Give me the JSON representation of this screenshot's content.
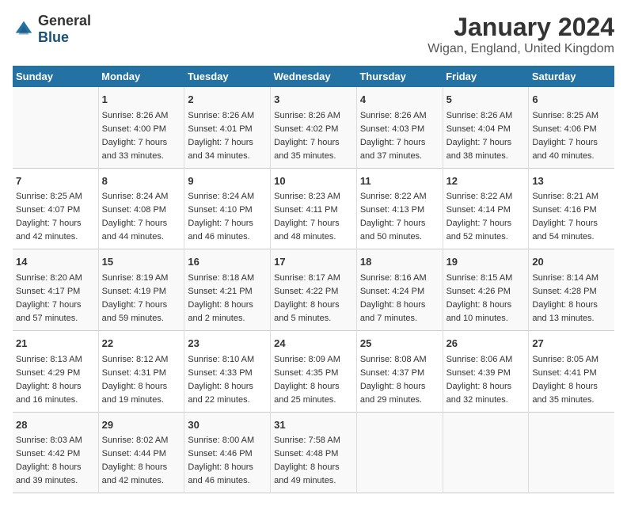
{
  "header": {
    "logo_general": "General",
    "logo_blue": "Blue",
    "title": "January 2024",
    "subtitle": "Wigan, England, United Kingdom"
  },
  "days_of_week": [
    "Sunday",
    "Monday",
    "Tuesday",
    "Wednesday",
    "Thursday",
    "Friday",
    "Saturday"
  ],
  "weeks": [
    [
      {
        "day": "",
        "content": ""
      },
      {
        "day": "1",
        "content": "Sunrise: 8:26 AM\nSunset: 4:00 PM\nDaylight: 7 hours\nand 33 minutes."
      },
      {
        "day": "2",
        "content": "Sunrise: 8:26 AM\nSunset: 4:01 PM\nDaylight: 7 hours\nand 34 minutes."
      },
      {
        "day": "3",
        "content": "Sunrise: 8:26 AM\nSunset: 4:02 PM\nDaylight: 7 hours\nand 35 minutes."
      },
      {
        "day": "4",
        "content": "Sunrise: 8:26 AM\nSunset: 4:03 PM\nDaylight: 7 hours\nand 37 minutes."
      },
      {
        "day": "5",
        "content": "Sunrise: 8:26 AM\nSunset: 4:04 PM\nDaylight: 7 hours\nand 38 minutes."
      },
      {
        "day": "6",
        "content": "Sunrise: 8:25 AM\nSunset: 4:06 PM\nDaylight: 7 hours\nand 40 minutes."
      }
    ],
    [
      {
        "day": "7",
        "content": "Sunrise: 8:25 AM\nSunset: 4:07 PM\nDaylight: 7 hours\nand 42 minutes."
      },
      {
        "day": "8",
        "content": "Sunrise: 8:24 AM\nSunset: 4:08 PM\nDaylight: 7 hours\nand 44 minutes."
      },
      {
        "day": "9",
        "content": "Sunrise: 8:24 AM\nSunset: 4:10 PM\nDaylight: 7 hours\nand 46 minutes."
      },
      {
        "day": "10",
        "content": "Sunrise: 8:23 AM\nSunset: 4:11 PM\nDaylight: 7 hours\nand 48 minutes."
      },
      {
        "day": "11",
        "content": "Sunrise: 8:22 AM\nSunset: 4:13 PM\nDaylight: 7 hours\nand 50 minutes."
      },
      {
        "day": "12",
        "content": "Sunrise: 8:22 AM\nSunset: 4:14 PM\nDaylight: 7 hours\nand 52 minutes."
      },
      {
        "day": "13",
        "content": "Sunrise: 8:21 AM\nSunset: 4:16 PM\nDaylight: 7 hours\nand 54 minutes."
      }
    ],
    [
      {
        "day": "14",
        "content": "Sunrise: 8:20 AM\nSunset: 4:17 PM\nDaylight: 7 hours\nand 57 minutes."
      },
      {
        "day": "15",
        "content": "Sunrise: 8:19 AM\nSunset: 4:19 PM\nDaylight: 7 hours\nand 59 minutes."
      },
      {
        "day": "16",
        "content": "Sunrise: 8:18 AM\nSunset: 4:21 PM\nDaylight: 8 hours\nand 2 minutes."
      },
      {
        "day": "17",
        "content": "Sunrise: 8:17 AM\nSunset: 4:22 PM\nDaylight: 8 hours\nand 5 minutes."
      },
      {
        "day": "18",
        "content": "Sunrise: 8:16 AM\nSunset: 4:24 PM\nDaylight: 8 hours\nand 7 minutes."
      },
      {
        "day": "19",
        "content": "Sunrise: 8:15 AM\nSunset: 4:26 PM\nDaylight: 8 hours\nand 10 minutes."
      },
      {
        "day": "20",
        "content": "Sunrise: 8:14 AM\nSunset: 4:28 PM\nDaylight: 8 hours\nand 13 minutes."
      }
    ],
    [
      {
        "day": "21",
        "content": "Sunrise: 8:13 AM\nSunset: 4:29 PM\nDaylight: 8 hours\nand 16 minutes."
      },
      {
        "day": "22",
        "content": "Sunrise: 8:12 AM\nSunset: 4:31 PM\nDaylight: 8 hours\nand 19 minutes."
      },
      {
        "day": "23",
        "content": "Sunrise: 8:10 AM\nSunset: 4:33 PM\nDaylight: 8 hours\nand 22 minutes."
      },
      {
        "day": "24",
        "content": "Sunrise: 8:09 AM\nSunset: 4:35 PM\nDaylight: 8 hours\nand 25 minutes."
      },
      {
        "day": "25",
        "content": "Sunrise: 8:08 AM\nSunset: 4:37 PM\nDaylight: 8 hours\nand 29 minutes."
      },
      {
        "day": "26",
        "content": "Sunrise: 8:06 AM\nSunset: 4:39 PM\nDaylight: 8 hours\nand 32 minutes."
      },
      {
        "day": "27",
        "content": "Sunrise: 8:05 AM\nSunset: 4:41 PM\nDaylight: 8 hours\nand 35 minutes."
      }
    ],
    [
      {
        "day": "28",
        "content": "Sunrise: 8:03 AM\nSunset: 4:42 PM\nDaylight: 8 hours\nand 39 minutes."
      },
      {
        "day": "29",
        "content": "Sunrise: 8:02 AM\nSunset: 4:44 PM\nDaylight: 8 hours\nand 42 minutes."
      },
      {
        "day": "30",
        "content": "Sunrise: 8:00 AM\nSunset: 4:46 PM\nDaylight: 8 hours\nand 46 minutes."
      },
      {
        "day": "31",
        "content": "Sunrise: 7:58 AM\nSunset: 4:48 PM\nDaylight: 8 hours\nand 49 minutes."
      },
      {
        "day": "",
        "content": ""
      },
      {
        "day": "",
        "content": ""
      },
      {
        "day": "",
        "content": ""
      }
    ]
  ]
}
